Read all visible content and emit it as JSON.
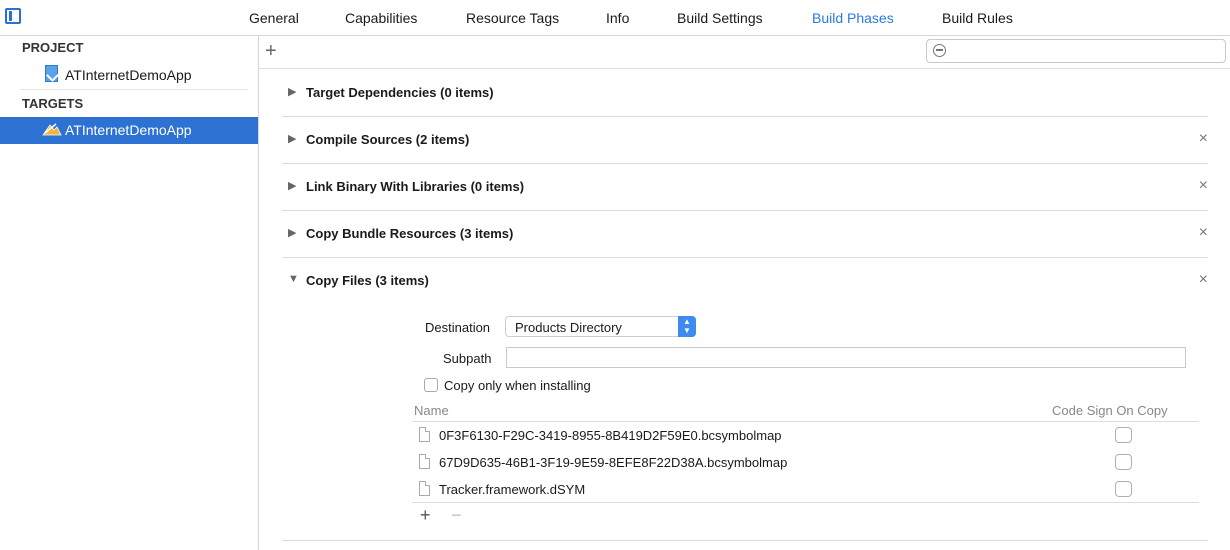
{
  "tabs": [
    "General",
    "Capabilities",
    "Resource Tags",
    "Info",
    "Build Settings",
    "Build Phases",
    "Build Rules"
  ],
  "active_tab": "Build Phases",
  "sidebar": {
    "project_header": "PROJECT",
    "project_item": "ATInternetDemoApp",
    "targets_header": "TARGETS",
    "target_item": "ATInternetDemoApp"
  },
  "toolbar": {
    "add_symbol": "+"
  },
  "phases": [
    {
      "title": "Target Dependencies (0 items)",
      "expanded": false,
      "deletable": false
    },
    {
      "title": "Compile Sources (2 items)",
      "expanded": false,
      "deletable": true
    },
    {
      "title": "Link Binary With Libraries (0 items)",
      "expanded": false,
      "deletable": true
    },
    {
      "title": "Copy Bundle Resources (3 items)",
      "expanded": false,
      "deletable": true
    },
    {
      "title": "Copy Files (3 items)",
      "expanded": true,
      "deletable": true
    }
  ],
  "copy_files": {
    "destination_label": "Destination",
    "destination_value": "Products Directory",
    "subpath_label": "Subpath",
    "subpath_value": "",
    "copy_only_label": "Copy only when installing",
    "copy_only_checked": false,
    "columns": {
      "name": "Name",
      "code_sign": "Code Sign On Copy"
    },
    "files": [
      {
        "name": "0F3F6130-F29C-3419-8955-8B419D2F59E0.bcsymbolmap",
        "code_sign": false
      },
      {
        "name": "67D9D635-46B1-3F19-9E59-8EFE8F22D38A.bcsymbolmap",
        "code_sign": false
      },
      {
        "name": "Tracker.framework.dSYM",
        "code_sign": false
      }
    ],
    "add_symbol": "+",
    "remove_symbol": "−"
  },
  "colors": {
    "accent": "#2a7ae0",
    "selection": "#2d72d2"
  },
  "icons": {
    "close": "×",
    "collapsed": "▶",
    "expanded": "▼"
  }
}
